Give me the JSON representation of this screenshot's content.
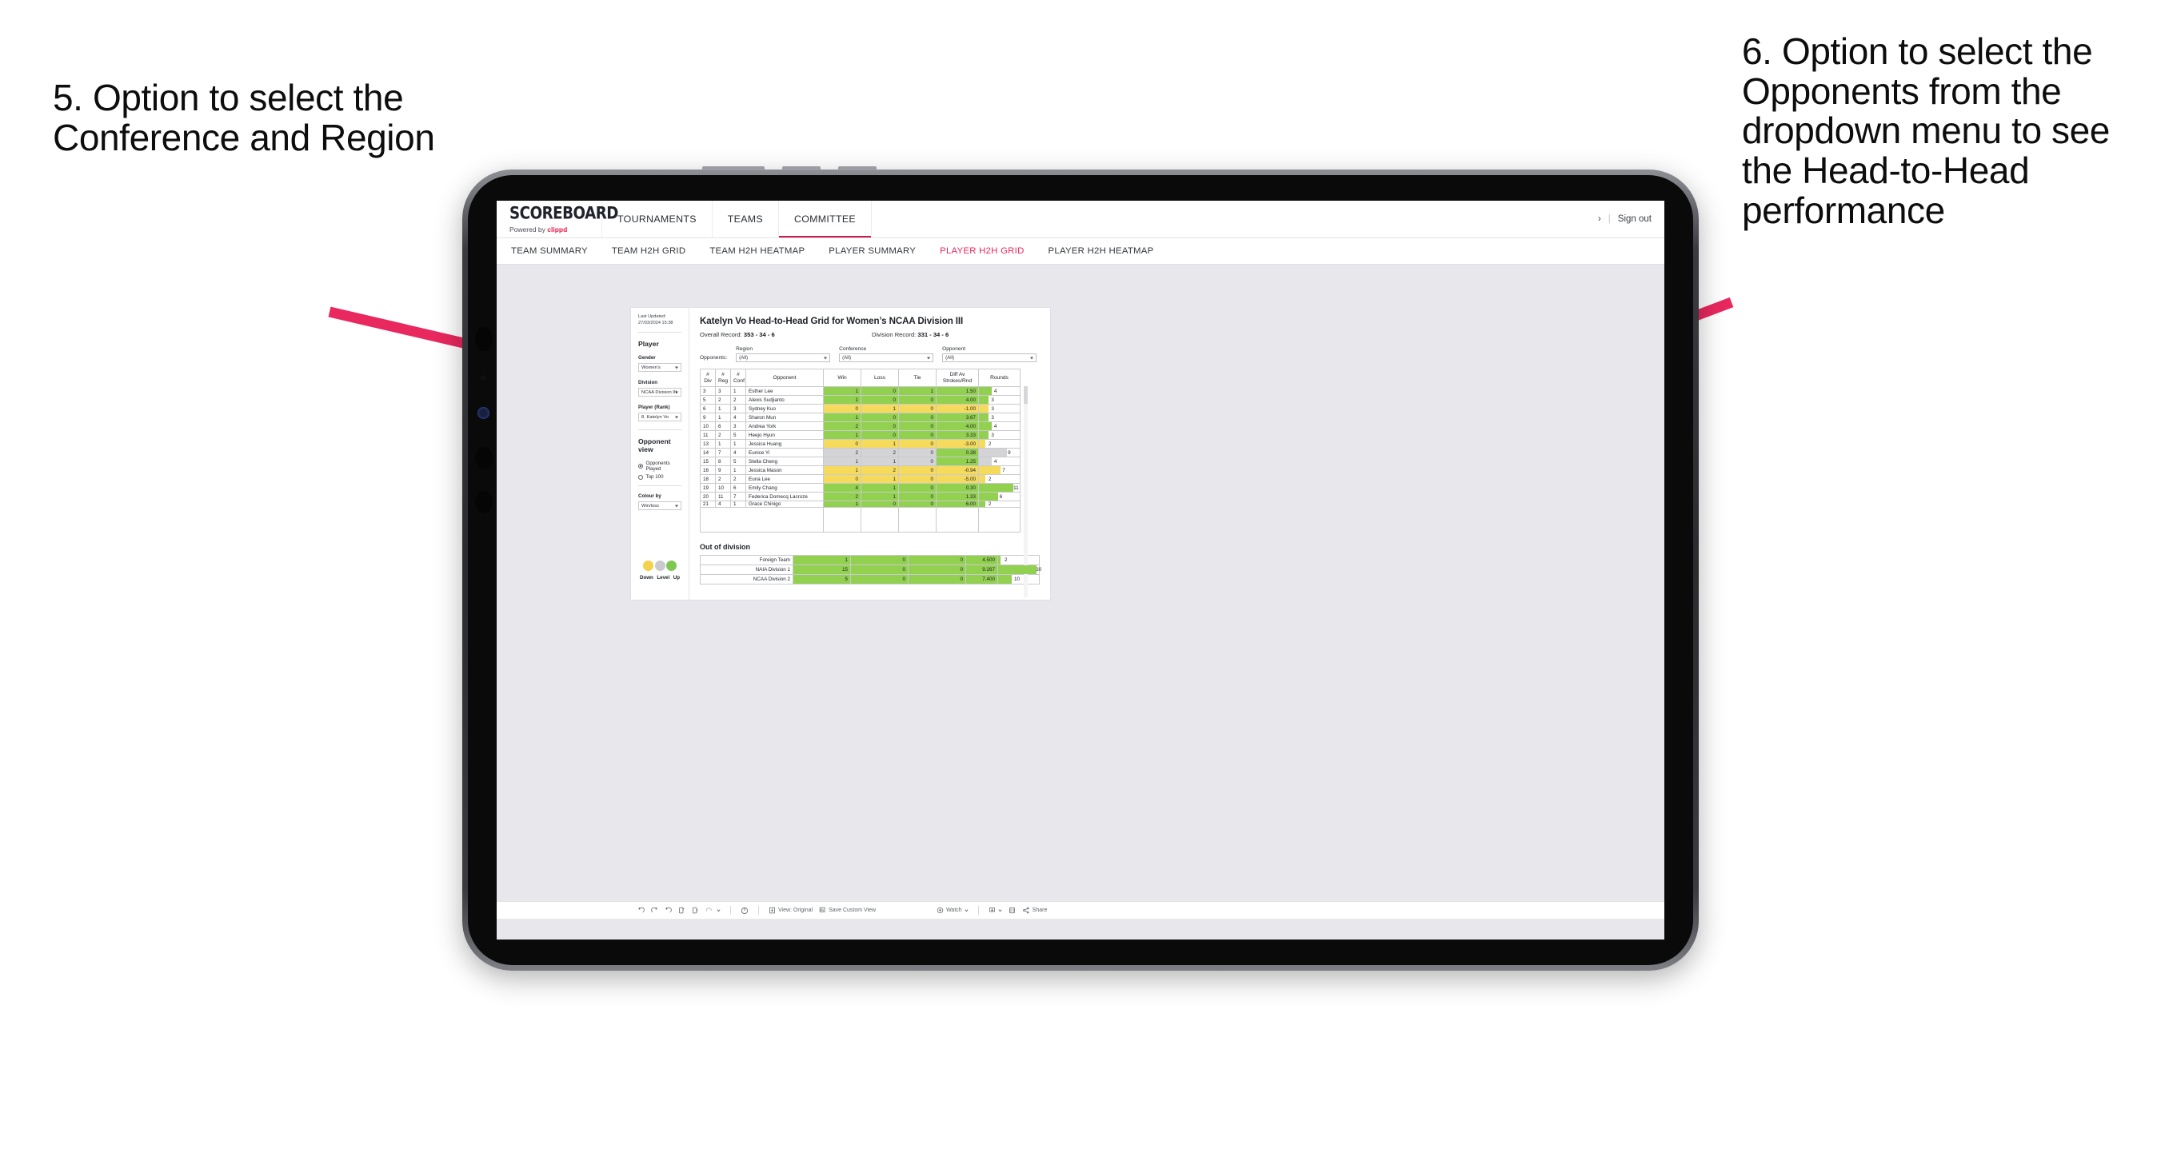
{
  "annotations": {
    "left": "5. Option to select the Conference and Region",
    "right": "6. Option to select the Opponents from the dropdown menu to see the Head-to-Head performance"
  },
  "colors": {
    "accent": "#c9184a",
    "active_tab": "#e8285e",
    "arrow": "#e8285e",
    "green": "#92d050",
    "yellow": "#f5da5c",
    "grey": "#d4d4d6",
    "canvas": "#e8e8ec"
  },
  "app": {
    "brand": {
      "title": "SCOREBOARD",
      "powered_prefix": "Powered by ",
      "powered_brand": "clippd"
    },
    "top_nav": [
      {
        "label": "TOURNAMENTS",
        "active": false
      },
      {
        "label": "TEAMS",
        "active": false
      },
      {
        "label": "COMMITTEE",
        "active": true
      }
    ],
    "account": {
      "chevron": "›",
      "separator": "|",
      "sign_out": "Sign out"
    },
    "sub_nav": [
      {
        "label": "TEAM SUMMARY",
        "active": false
      },
      {
        "label": "TEAM H2H GRID",
        "active": false
      },
      {
        "label": "TEAM H2H HEATMAP",
        "active": false
      },
      {
        "label": "PLAYER SUMMARY",
        "active": false
      },
      {
        "label": "PLAYER H2H GRID",
        "active": true
      },
      {
        "label": "PLAYER H2H HEATMAP",
        "active": false
      }
    ]
  },
  "sidebar": {
    "last_updated": "Last Updated: 27/03/2024\n15:38",
    "player_heading": "Player",
    "fields": [
      {
        "label": "Gender",
        "value": "Women's"
      },
      {
        "label": "Division",
        "value": "NCAA Division III"
      },
      {
        "label": "Player (Rank)",
        "value": "8. Katelyn Vo"
      }
    ],
    "opponent_view": {
      "heading": "Opponent view",
      "options": [
        {
          "label": "Opponents Played",
          "selected": true
        },
        {
          "label": "Top 100",
          "selected": false
        }
      ]
    },
    "colour_by": {
      "label": "Colour by",
      "value": "Win/loss"
    },
    "legend": [
      {
        "label": "Down",
        "color": "#f2d24b"
      },
      {
        "label": "Level",
        "color": "#c9cacd"
      },
      {
        "label": "Up",
        "color": "#7ec850"
      }
    ]
  },
  "main": {
    "title": "Katelyn Vo Head-to-Head Grid for Women’s NCAA Division III",
    "overall_record_label": "Overall Record: ",
    "overall_record_value": "353 - 34 - 6",
    "division_record_label": "Division Record: ",
    "division_record_value": "331 -  34 - 6",
    "opponents_label": "Opponents:",
    "dropdowns": [
      {
        "label": "Region",
        "value": "(All)"
      },
      {
        "label": "Conference",
        "value": "(All)"
      },
      {
        "label": "Opponent",
        "value": "(All)"
      }
    ]
  },
  "chart_data": {
    "type": "table",
    "title": "Katelyn Vo Head-to-Head Grid for Women’s NCAA Division III",
    "columns": [
      "# Div",
      "# Reg",
      "# Conf",
      "Opponent",
      "Win",
      "Loss",
      "Tie",
      "Diff Av Strokes/Rnd",
      "Rounds"
    ],
    "rows": [
      {
        "div": "3",
        "reg": "3",
        "conf": "1",
        "opponent": "Esther Lee",
        "win": "1",
        "loss": "0",
        "tie": "1",
        "diff": "1.50",
        "rounds": "4",
        "status": "up"
      },
      {
        "div": "5",
        "reg": "2",
        "conf": "2",
        "opponent": "Alexis Sudjianto",
        "win": "1",
        "loss": "0",
        "tie": "0",
        "diff": "4.00",
        "rounds": "3",
        "status": "up"
      },
      {
        "div": "6",
        "reg": "1",
        "conf": "3",
        "opponent": "Sydney Kuo",
        "win": "0",
        "loss": "1",
        "tie": "0",
        "diff": "-1.00",
        "rounds": "3",
        "status": "down"
      },
      {
        "div": "9",
        "reg": "1",
        "conf": "4",
        "opponent": "Sharon Mun",
        "win": "1",
        "loss": "0",
        "tie": "0",
        "diff": "3.67",
        "rounds": "3",
        "status": "up"
      },
      {
        "div": "10",
        "reg": "6",
        "conf": "3",
        "opponent": "Andrea York",
        "win": "2",
        "loss": "0",
        "tie": "0",
        "diff": "4.00",
        "rounds": "4",
        "status": "up"
      },
      {
        "div": "11",
        "reg": "2",
        "conf": "5",
        "opponent": "Heejo Hyun",
        "win": "1",
        "loss": "0",
        "tie": "0",
        "diff": "3.33",
        "rounds": "3",
        "status": "up"
      },
      {
        "div": "13",
        "reg": "1",
        "conf": "1",
        "opponent": "Jessica Huang",
        "win": "0",
        "loss": "1",
        "tie": "0",
        "diff": "-3.00",
        "rounds": "2",
        "status": "down"
      },
      {
        "div": "14",
        "reg": "7",
        "conf": "4",
        "opponent": "Eunice Yi",
        "win": "2",
        "loss": "2",
        "tie": "0",
        "diff": "0.38",
        "rounds": "9",
        "status": "level"
      },
      {
        "div": "15",
        "reg": "8",
        "conf": "5",
        "opponent": "Stella Cheng",
        "win": "1",
        "loss": "1",
        "tie": "0",
        "diff": "1.25",
        "rounds": "4",
        "status": "level"
      },
      {
        "div": "16",
        "reg": "9",
        "conf": "1",
        "opponent": "Jessica Mason",
        "win": "1",
        "loss": "2",
        "tie": "0",
        "diff": "-0.94",
        "rounds": "7",
        "status": "down"
      },
      {
        "div": "18",
        "reg": "2",
        "conf": "2",
        "opponent": "Euna Lee",
        "win": "0",
        "loss": "1",
        "tie": "0",
        "diff": "-5.00",
        "rounds": "2",
        "status": "down"
      },
      {
        "div": "19",
        "reg": "10",
        "conf": "6",
        "opponent": "Emily Chang",
        "win": "4",
        "loss": "1",
        "tie": "0",
        "diff": "0.30",
        "rounds": "11",
        "status": "up"
      },
      {
        "div": "20",
        "reg": "11",
        "conf": "7",
        "opponent": "Federica Domecq Lacroze",
        "win": "2",
        "loss": "1",
        "tie": "0",
        "diff": "1.33",
        "rounds": "6",
        "status": "up"
      }
    ],
    "out_of_division": {
      "title": "Out of division",
      "rows": [
        {
          "name": "Foreign Team",
          "win": "1",
          "loss": "0",
          "tie": "0",
          "diff": "4.500",
          "rounds": "2",
          "status": "up"
        },
        {
          "name": "NAIA Division 1",
          "win": "15",
          "loss": "0",
          "tie": "0",
          "diff": "9.267",
          "rounds": "30",
          "status": "up"
        },
        {
          "name": "NCAA Division 2",
          "win": "5",
          "loss": "0",
          "tie": "0",
          "diff": "7.400",
          "rounds": "10",
          "status": "up"
        }
      ]
    }
  },
  "toolbar": {
    "view_label": "View: Original",
    "save_label": "Save Custom View",
    "watch_label": "Watch",
    "share_label": "Share"
  }
}
